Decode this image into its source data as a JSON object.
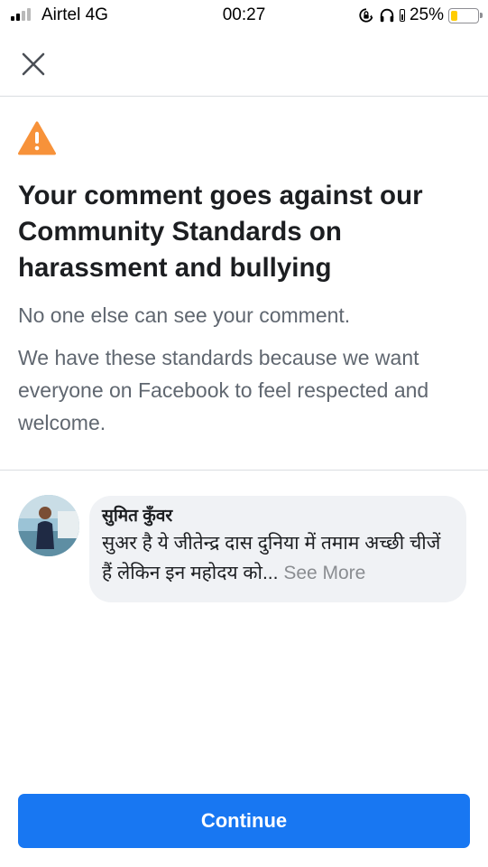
{
  "status_bar": {
    "carrier": "Airtel 4G",
    "time": "00:27",
    "battery_percent": "25%",
    "battery_level": 0.25,
    "icons": [
      "signal-icon",
      "rotation-lock-icon",
      "headphones-icon",
      "battery-icon"
    ]
  },
  "header": {
    "close_icon": "close-icon"
  },
  "notice": {
    "icon": "warning-icon",
    "icon_color": "#f7923a",
    "title": "Your comment goes against our Community Standards on harassment and bullying",
    "subtitle": "No one else can see your comment.",
    "body": "We have these standards because we want everyone on Facebook to feel respected and welcome."
  },
  "comment": {
    "author": "सुमित कुँवर",
    "text": "सुअर है ये जीतेन्द्र दास दुनिया में तमाम अच्छी चीजें हैं लेकिन इन महोदय को...",
    "see_more": "See More"
  },
  "footer": {
    "continue_label": "Continue",
    "accent": "#1877f2"
  }
}
